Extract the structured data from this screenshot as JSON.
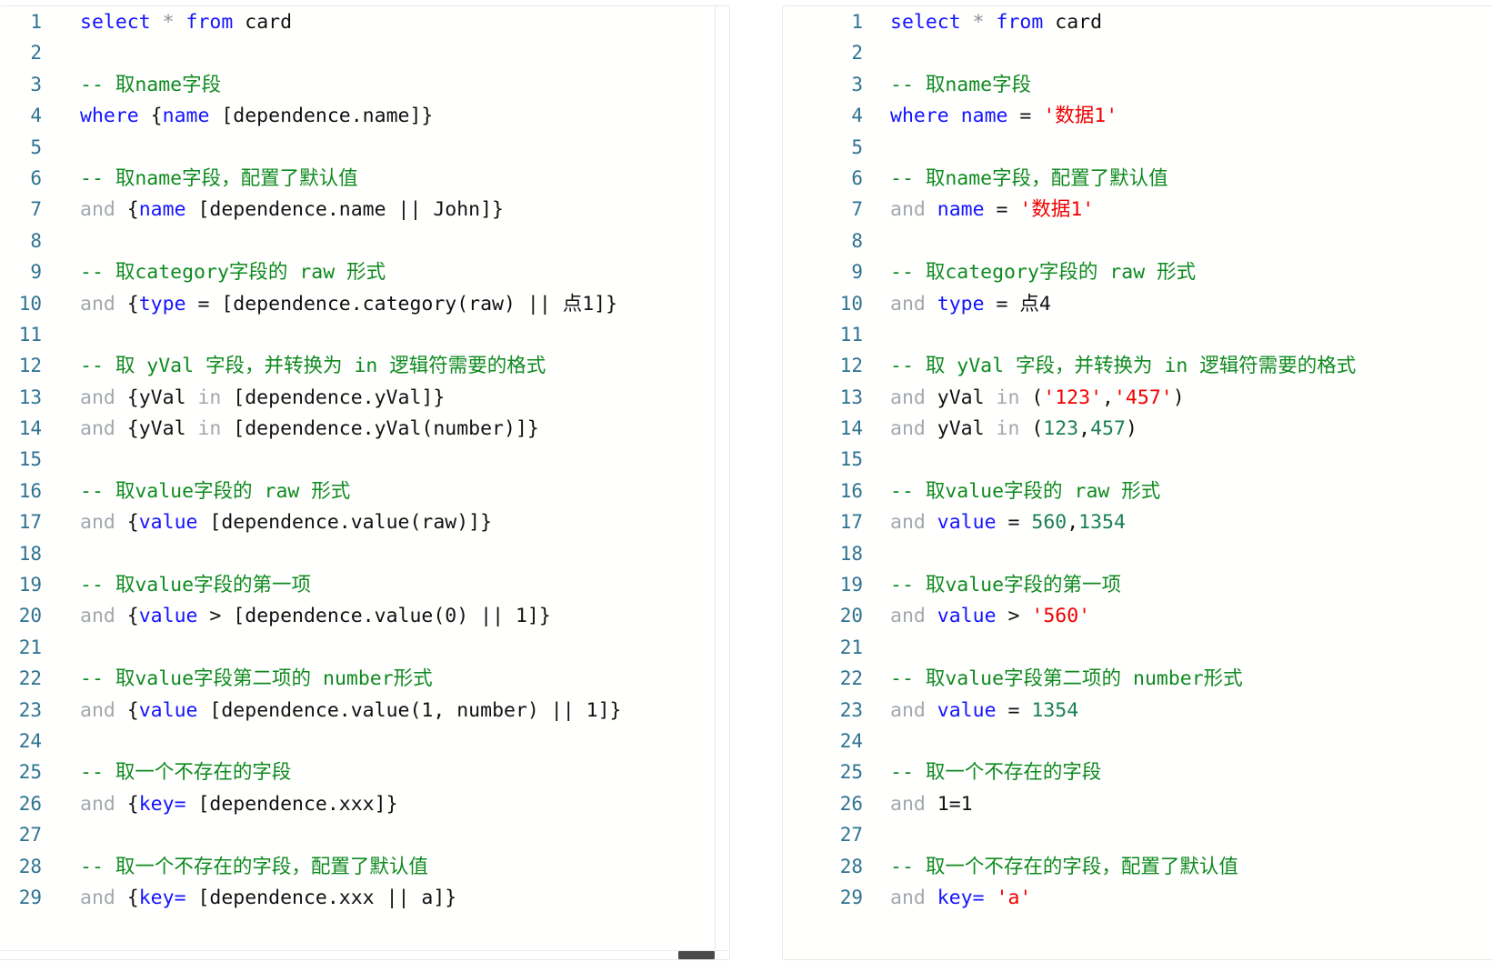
{
  "theme": {
    "background": "#ffffff",
    "panel_background": "#fffffe",
    "panel_border": "#e8e8e8",
    "line_number_color": "#2f7391",
    "keyword_color": "#1414ff",
    "muted_keyword_color": "#a3a8ae",
    "comment_color": "#0f8a1f",
    "string_color": "#f00000",
    "number_color": "#1a7f5a",
    "plain_color": "#111111",
    "scrollbar_thumb_color": "#4a4a4a"
  },
  "panels": [
    {
      "id": "template-editor",
      "name": "sql-template-editor",
      "scrollbars": {
        "vertical": true,
        "horizontal": true
      },
      "lines": [
        {
          "n": "1",
          "tokens": [
            {
              "t": "select",
              "c": "kw"
            },
            {
              "t": " ",
              "c": "plain"
            },
            {
              "t": "*",
              "c": "star"
            },
            {
              "t": " ",
              "c": "plain"
            },
            {
              "t": "from",
              "c": "kw"
            },
            {
              "t": " card",
              "c": "plain"
            }
          ]
        },
        {
          "n": "2",
          "tokens": []
        },
        {
          "n": "3",
          "tokens": [
            {
              "t": "-- 取name字段",
              "c": "comment"
            }
          ]
        },
        {
          "n": "4",
          "tokens": [
            {
              "t": "where",
              "c": "kw"
            },
            {
              "t": " {",
              "c": "plain"
            },
            {
              "t": "name",
              "c": "kw"
            },
            {
              "t": " [dependence.name]}",
              "c": "plain"
            }
          ]
        },
        {
          "n": "5",
          "tokens": []
        },
        {
          "n": "6",
          "tokens": [
            {
              "t": "-- 取name字段，配置了默认值",
              "c": "comment"
            }
          ]
        },
        {
          "n": "7",
          "tokens": [
            {
              "t": "and",
              "c": "and"
            },
            {
              "t": " {",
              "c": "plain"
            },
            {
              "t": "name",
              "c": "kw"
            },
            {
              "t": " [dependence.name || John]}",
              "c": "plain"
            }
          ]
        },
        {
          "n": "8",
          "tokens": []
        },
        {
          "n": "9",
          "tokens": [
            {
              "t": "-- 取category字段的 raw 形式",
              "c": "comment"
            }
          ]
        },
        {
          "n": "10",
          "tokens": [
            {
              "t": "and",
              "c": "and"
            },
            {
              "t": " {",
              "c": "plain"
            },
            {
              "t": "type",
              "c": "kw"
            },
            {
              "t": " = [dependence.category(raw) || 点1]}",
              "c": "plain"
            }
          ]
        },
        {
          "n": "11",
          "tokens": []
        },
        {
          "n": "12",
          "tokens": [
            {
              "t": "-- 取 yVal 字段，并转换为 in 逻辑符需要的格式",
              "c": "comment"
            }
          ]
        },
        {
          "n": "13",
          "tokens": [
            {
              "t": "and",
              "c": "and"
            },
            {
              "t": " {yVal ",
              "c": "plain"
            },
            {
              "t": "in",
              "c": "and"
            },
            {
              "t": " [dependence.yVal]}",
              "c": "plain"
            }
          ]
        },
        {
          "n": "14",
          "tokens": [
            {
              "t": "and",
              "c": "and"
            },
            {
              "t": " {yVal ",
              "c": "plain"
            },
            {
              "t": "in",
              "c": "and"
            },
            {
              "t": " [dependence.yVal(number)]}",
              "c": "plain"
            }
          ]
        },
        {
          "n": "15",
          "tokens": []
        },
        {
          "n": "16",
          "tokens": [
            {
              "t": "-- 取value字段的 raw 形式",
              "c": "comment"
            }
          ]
        },
        {
          "n": "17",
          "tokens": [
            {
              "t": "and",
              "c": "and"
            },
            {
              "t": " {",
              "c": "plain"
            },
            {
              "t": "value",
              "c": "kw"
            },
            {
              "t": " [dependence.value(raw)]}",
              "c": "plain"
            }
          ]
        },
        {
          "n": "18",
          "tokens": []
        },
        {
          "n": "19",
          "tokens": [
            {
              "t": "-- 取value字段的第一项",
              "c": "comment"
            }
          ]
        },
        {
          "n": "20",
          "tokens": [
            {
              "t": "and",
              "c": "and"
            },
            {
              "t": " {",
              "c": "plain"
            },
            {
              "t": "value",
              "c": "kw"
            },
            {
              "t": " > [dependence.value(0) || 1]}",
              "c": "plain"
            }
          ]
        },
        {
          "n": "21",
          "tokens": []
        },
        {
          "n": "22",
          "tokens": [
            {
              "t": "-- 取value字段第二项的 number形式",
              "c": "comment"
            }
          ]
        },
        {
          "n": "23",
          "tokens": [
            {
              "t": "and",
              "c": "and"
            },
            {
              "t": " {",
              "c": "plain"
            },
            {
              "t": "value",
              "c": "kw"
            },
            {
              "t": " [dependence.value(1, number) || 1]}",
              "c": "plain"
            }
          ]
        },
        {
          "n": "24",
          "tokens": []
        },
        {
          "n": "25",
          "tokens": [
            {
              "t": "-- 取一个不存在的字段",
              "c": "comment"
            }
          ]
        },
        {
          "n": "26",
          "tokens": [
            {
              "t": "and",
              "c": "and"
            },
            {
              "t": " {",
              "c": "plain"
            },
            {
              "t": "key=",
              "c": "kw"
            },
            {
              "t": " [dependence.xxx]}",
              "c": "plain"
            }
          ]
        },
        {
          "n": "27",
          "tokens": []
        },
        {
          "n": "28",
          "tokens": [
            {
              "t": "-- 取一个不存在的字段，配置了默认值",
              "c": "comment"
            }
          ]
        },
        {
          "n": "29",
          "tokens": [
            {
              "t": "and",
              "c": "and"
            },
            {
              "t": " {",
              "c": "plain"
            },
            {
              "t": "key=",
              "c": "kw"
            },
            {
              "t": " [dependence.xxx || a]}",
              "c": "plain"
            }
          ]
        }
      ]
    },
    {
      "id": "result-editor",
      "name": "sql-result-editor",
      "scrollbars": {
        "vertical": false,
        "horizontal": false
      },
      "lines": [
        {
          "n": "1",
          "tokens": [
            {
              "t": "select",
              "c": "kw"
            },
            {
              "t": " ",
              "c": "plain"
            },
            {
              "t": "*",
              "c": "star"
            },
            {
              "t": " ",
              "c": "plain"
            },
            {
              "t": "from",
              "c": "kw"
            },
            {
              "t": " card",
              "c": "plain"
            }
          ]
        },
        {
          "n": "2",
          "tokens": []
        },
        {
          "n": "3",
          "tokens": [
            {
              "t": "-- 取name字段",
              "c": "comment"
            }
          ]
        },
        {
          "n": "4",
          "tokens": [
            {
              "t": "where",
              "c": "kw"
            },
            {
              "t": " ",
              "c": "plain"
            },
            {
              "t": "name",
              "c": "kw"
            },
            {
              "t": " = ",
              "c": "plain"
            },
            {
              "t": "'数据1'",
              "c": "str"
            }
          ]
        },
        {
          "n": "5",
          "tokens": []
        },
        {
          "n": "6",
          "tokens": [
            {
              "t": "-- 取name字段，配置了默认值",
              "c": "comment"
            }
          ]
        },
        {
          "n": "7",
          "tokens": [
            {
              "t": "and",
              "c": "and"
            },
            {
              "t": " ",
              "c": "plain"
            },
            {
              "t": "name",
              "c": "kw"
            },
            {
              "t": " = ",
              "c": "plain"
            },
            {
              "t": "'数据1'",
              "c": "str"
            }
          ]
        },
        {
          "n": "8",
          "tokens": []
        },
        {
          "n": "9",
          "tokens": [
            {
              "t": "-- 取category字段的 raw 形式",
              "c": "comment"
            }
          ]
        },
        {
          "n": "10",
          "tokens": [
            {
              "t": "and",
              "c": "and"
            },
            {
              "t": " ",
              "c": "plain"
            },
            {
              "t": "type",
              "c": "kw"
            },
            {
              "t": " = 点4",
              "c": "plain"
            }
          ]
        },
        {
          "n": "11",
          "tokens": []
        },
        {
          "n": "12",
          "tokens": [
            {
              "t": "-- 取 yVal 字段，并转换为 in 逻辑符需要的格式",
              "c": "comment"
            }
          ]
        },
        {
          "n": "13",
          "tokens": [
            {
              "t": "and",
              "c": "and"
            },
            {
              "t": " yVal ",
              "c": "plain"
            },
            {
              "t": "in",
              "c": "and"
            },
            {
              "t": " (",
              "c": "plain"
            },
            {
              "t": "'123'",
              "c": "str"
            },
            {
              "t": ",",
              "c": "plain"
            },
            {
              "t": "'457'",
              "c": "str"
            },
            {
              "t": ")",
              "c": "plain"
            }
          ]
        },
        {
          "n": "14",
          "tokens": [
            {
              "t": "and",
              "c": "and"
            },
            {
              "t": " yVal ",
              "c": "plain"
            },
            {
              "t": "in",
              "c": "and"
            },
            {
              "t": " (",
              "c": "plain"
            },
            {
              "t": "123",
              "c": "num"
            },
            {
              "t": ",",
              "c": "plain"
            },
            {
              "t": "457",
              "c": "num"
            },
            {
              "t": ")",
              "c": "plain"
            }
          ]
        },
        {
          "n": "15",
          "tokens": []
        },
        {
          "n": "16",
          "tokens": [
            {
              "t": "-- 取value字段的 raw 形式",
              "c": "comment"
            }
          ]
        },
        {
          "n": "17",
          "tokens": [
            {
              "t": "and",
              "c": "and"
            },
            {
              "t": " ",
              "c": "plain"
            },
            {
              "t": "value",
              "c": "kw"
            },
            {
              "t": " = ",
              "c": "plain"
            },
            {
              "t": "560",
              "c": "num"
            },
            {
              "t": ",",
              "c": "plain"
            },
            {
              "t": "1354",
              "c": "num"
            }
          ]
        },
        {
          "n": "18",
          "tokens": []
        },
        {
          "n": "19",
          "tokens": [
            {
              "t": "-- 取value字段的第一项",
              "c": "comment"
            }
          ]
        },
        {
          "n": "20",
          "tokens": [
            {
              "t": "and",
              "c": "and"
            },
            {
              "t": " ",
              "c": "plain"
            },
            {
              "t": "value",
              "c": "kw"
            },
            {
              "t": " > ",
              "c": "plain"
            },
            {
              "t": "'560'",
              "c": "str"
            }
          ]
        },
        {
          "n": "21",
          "tokens": []
        },
        {
          "n": "22",
          "tokens": [
            {
              "t": "-- 取value字段第二项的 number形式",
              "c": "comment"
            }
          ]
        },
        {
          "n": "23",
          "tokens": [
            {
              "t": "and",
              "c": "and"
            },
            {
              "t": " ",
              "c": "plain"
            },
            {
              "t": "value",
              "c": "kw"
            },
            {
              "t": " = ",
              "c": "plain"
            },
            {
              "t": "1354",
              "c": "num"
            }
          ]
        },
        {
          "n": "24",
          "tokens": []
        },
        {
          "n": "25",
          "tokens": [
            {
              "t": "-- 取一个不存在的字段",
              "c": "comment"
            }
          ]
        },
        {
          "n": "26",
          "tokens": [
            {
              "t": "and",
              "c": "and"
            },
            {
              "t": " 1=1",
              "c": "plain"
            }
          ]
        },
        {
          "n": "27",
          "tokens": []
        },
        {
          "n": "28",
          "tokens": [
            {
              "t": "-- 取一个不存在的字段，配置了默认值",
              "c": "comment"
            }
          ]
        },
        {
          "n": "29",
          "tokens": [
            {
              "t": "and",
              "c": "and"
            },
            {
              "t": " ",
              "c": "plain"
            },
            {
              "t": "key=",
              "c": "kw"
            },
            {
              "t": " ",
              "c": "plain"
            },
            {
              "t": "'a'",
              "c": "str"
            }
          ]
        }
      ]
    }
  ]
}
